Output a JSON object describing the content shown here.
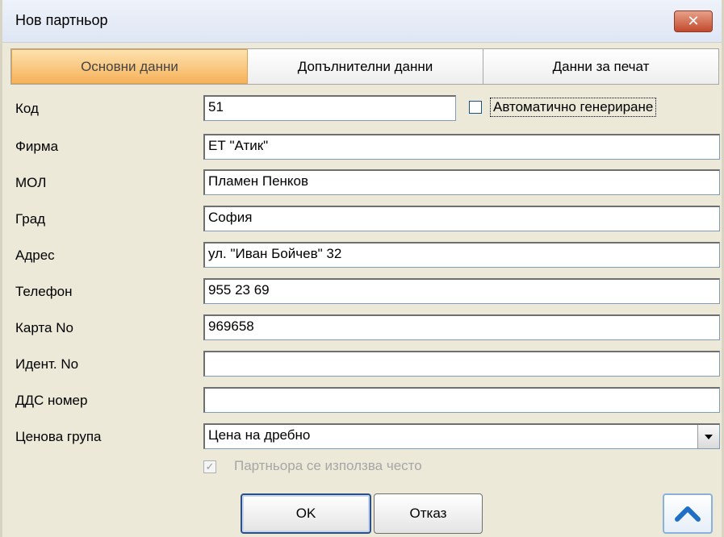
{
  "window": {
    "title": "Нов партньор",
    "close_label": "✕"
  },
  "tabs": [
    {
      "label": "Основни данни",
      "active": true
    },
    {
      "label": "Допълнителни данни",
      "active": false
    },
    {
      "label": "Данни за печат",
      "active": false
    }
  ],
  "form": {
    "code": {
      "label": "Код",
      "value": "51"
    },
    "auto_generate": {
      "label": "Автоматично генериране",
      "checked": false
    },
    "company": {
      "label": "Фирма",
      "value": "ЕТ \"Атик\""
    },
    "mol": {
      "label": "МОЛ",
      "value": "Пламен Пенков"
    },
    "city": {
      "label": "Град",
      "value": "София"
    },
    "address": {
      "label": "Адрес",
      "value": "ул. \"Иван Бойчев\" 32"
    },
    "phone": {
      "label": "Телефон",
      "value": "955 23 69"
    },
    "card_no": {
      "label": "Карта No",
      "value": "969658"
    },
    "ident_no": {
      "label": "Идент. No",
      "value": ""
    },
    "vat_no": {
      "label": "ДДС номер",
      "value": ""
    },
    "price_group": {
      "label": "Ценова група",
      "value": "Цена на дребно"
    },
    "frequent": {
      "label": "Партньора се използва често",
      "checked": true,
      "disabled": true
    }
  },
  "buttons": {
    "ok": "OK",
    "cancel": "Отказ"
  },
  "icons": {
    "close": "close-icon",
    "dropdown": "chevron-down-icon",
    "up": "chevron-up-icon"
  },
  "colors": {
    "active_tab": "#f6b25a",
    "close_button": "#c24a2d",
    "up_chevron": "#1f6fc4"
  }
}
